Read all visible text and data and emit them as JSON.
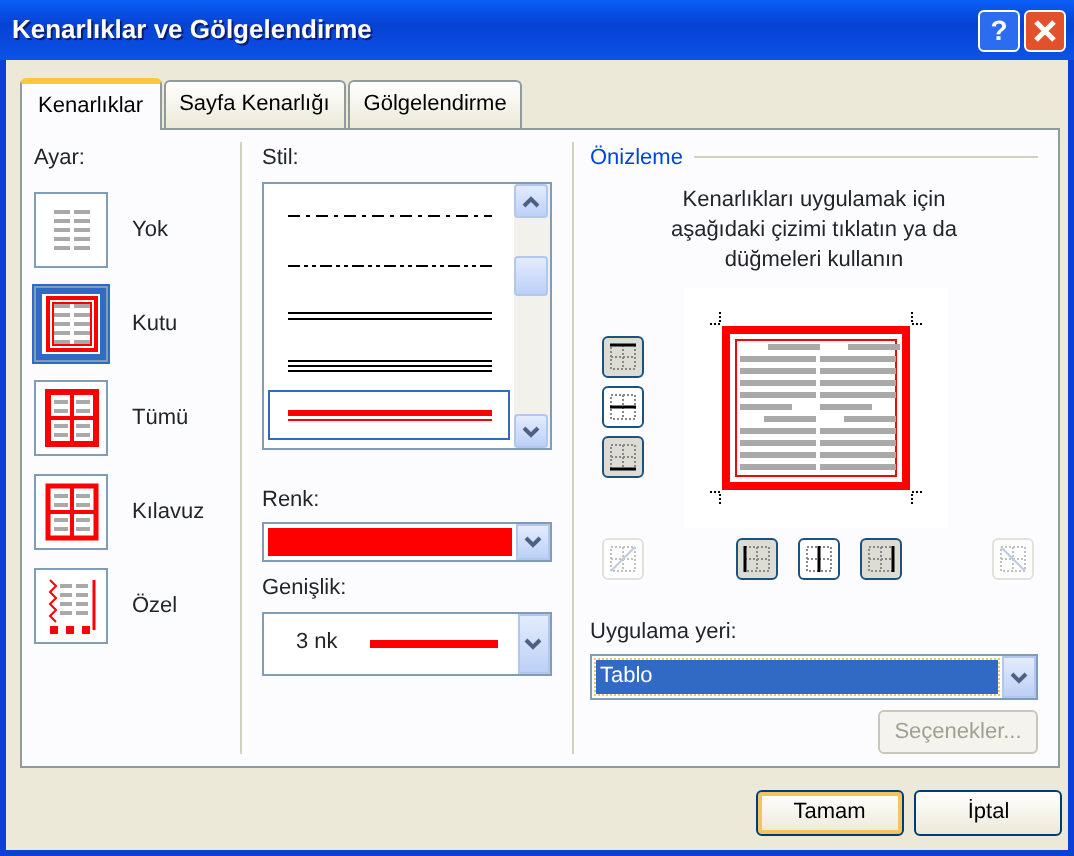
{
  "window": {
    "title": "Kenarlıklar ve Gölgelendirme",
    "help": "?"
  },
  "tabs": [
    {
      "label": "Kenarlıklar",
      "selected": true
    },
    {
      "label": "Sayfa Kenarlığı",
      "selected": false
    },
    {
      "label": "Gölgelendirme",
      "selected": false
    }
  ],
  "setting": {
    "label": "Ayar:",
    "items": [
      {
        "label": "Yok",
        "kind": "none",
        "selected": false
      },
      {
        "label": "Kutu",
        "kind": "box",
        "selected": true
      },
      {
        "label": "Tümü",
        "kind": "all",
        "selected": false
      },
      {
        "label": "Kılavuz",
        "kind": "grid",
        "selected": false
      },
      {
        "label": "Özel",
        "kind": "custom",
        "selected": false
      }
    ]
  },
  "style": {
    "label": "Stil:",
    "items": [
      {
        "kind": "dash-dot",
        "selected": false
      },
      {
        "kind": "dash-dot-dot",
        "selected": false
      },
      {
        "kind": "double",
        "selected": false
      },
      {
        "kind": "triple",
        "selected": false
      },
      {
        "kind": "thick-thin",
        "selected": true
      }
    ]
  },
  "color": {
    "label": "Renk:",
    "color": "#ff0000"
  },
  "width": {
    "label": "Genişlik:",
    "value": "3 nk"
  },
  "preview": {
    "title": "Önizleme",
    "instructions": "Kenarlıkları uygulamak için aşağıdaki çizimi tıklatın ya da düğmeleri kullanın",
    "side_buttons": [
      {
        "kind": "top",
        "pressed": true
      },
      {
        "kind": "middle",
        "pressed": false
      },
      {
        "kind": "bottom",
        "pressed": true
      }
    ],
    "bottom_buttons": [
      {
        "kind": "diag-up",
        "pressed": false,
        "disabled": true
      },
      {
        "kind": "left",
        "pressed": true,
        "disabled": false
      },
      {
        "kind": "center",
        "pressed": false,
        "disabled": false
      },
      {
        "kind": "right",
        "pressed": true,
        "disabled": false
      },
      {
        "kind": "diag-down",
        "pressed": false,
        "disabled": true
      }
    ]
  },
  "apply_to": {
    "label": "Uygulama yeri:",
    "value": "Tablo"
  },
  "options_button": {
    "label": "Seçenekler...",
    "disabled": true
  },
  "buttons": [
    {
      "label": "Tamam",
      "default": true
    },
    {
      "label": "İptal",
      "default": false
    }
  ]
}
